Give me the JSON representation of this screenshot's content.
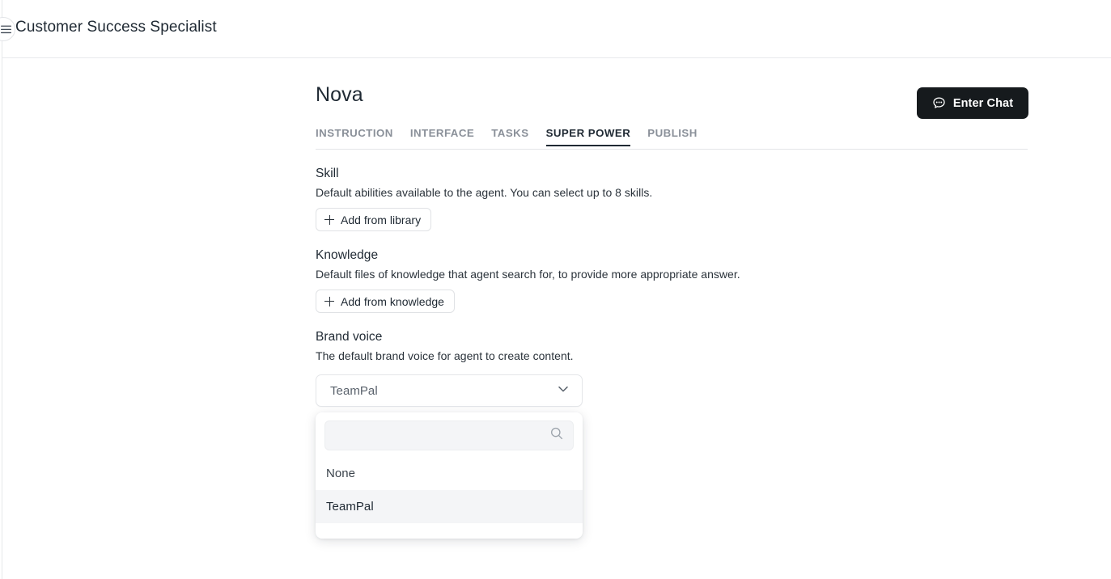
{
  "topbar": {
    "menu_icon": "hamburger-menu-icon",
    "title": "Customer Success Specialist"
  },
  "header": {
    "agent_name": "Nova",
    "enter_chat_label": "Enter Chat",
    "enter_chat_icon": "chat-bubble-icon"
  },
  "tabs": [
    {
      "label": "INSTRUCTION",
      "active": false
    },
    {
      "label": "INTERFACE",
      "active": false
    },
    {
      "label": "TASKS",
      "active": false
    },
    {
      "label": "SUPER POWER",
      "active": true
    },
    {
      "label": "PUBLISH",
      "active": false
    }
  ],
  "sections": {
    "skill": {
      "title": "Skill",
      "description": "Default abilities available to the agent. You can select up to 8 skills.",
      "button_label": "Add from library",
      "button_icon": "plus-icon"
    },
    "knowledge": {
      "title": "Knowledge",
      "description": "Default files of knowledge that agent search for, to provide more appropriate answer.",
      "button_label": "Add from knowledge",
      "button_icon": "plus-icon"
    },
    "brand_voice": {
      "title": "Brand voice",
      "description": "The default brand voice for agent to create content.",
      "select_value": "TeamPal",
      "chevron_icon": "chevron-down-icon",
      "dropdown": {
        "search_placeholder": "",
        "search_value": "",
        "search_icon": "search-icon",
        "options": [
          {
            "label": "None",
            "selected": false
          },
          {
            "label": "TeamPal",
            "selected": true
          }
        ]
      }
    }
  },
  "colors": {
    "accent_dark": "#161a1d",
    "text_primary": "#1f2933",
    "text_muted": "#8a9099",
    "border": "#e3e5e8",
    "highlight_row": "#f4f5f7"
  }
}
